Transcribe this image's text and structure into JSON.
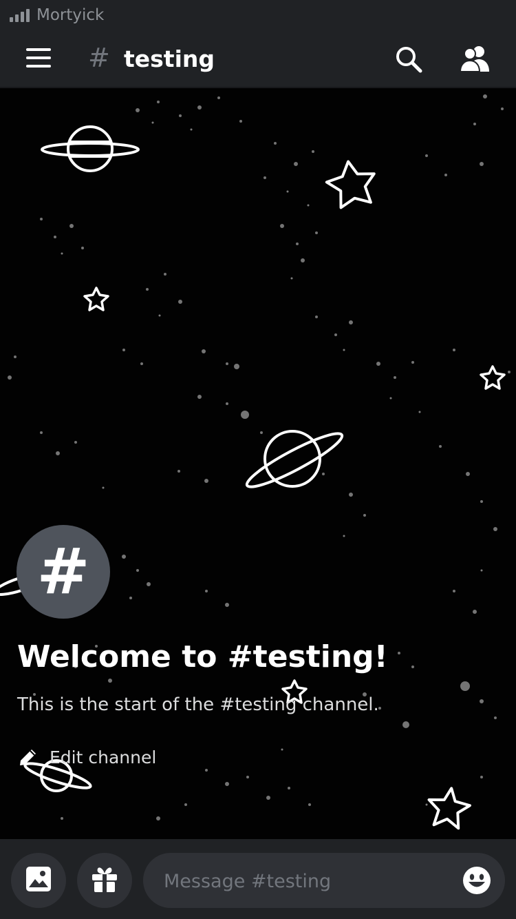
{
  "status_bar": {
    "carrier": "Mortyick"
  },
  "header": {
    "channel_prefix": "#",
    "channel_name": "testing"
  },
  "welcome": {
    "avatar_glyph": "#",
    "title": "Welcome to #testing!",
    "subtitle": "This is the start of the #testing channel.",
    "edit_label": "Edit channel"
  },
  "composer": {
    "placeholder": "Message #testing"
  },
  "icons": {
    "menu": "hamburger-menu-icon",
    "search": "search-icon",
    "members": "members-icon",
    "edit": "pencil-icon",
    "image": "image-icon",
    "gift": "gift-icon",
    "emoji": "emoji-icon"
  },
  "colors": {
    "header_bg": "#202225",
    "input_bg": "#2f3136",
    "avatar_bg": "#4f545c",
    "muted_text": "#72767d",
    "white": "#ffffff"
  }
}
